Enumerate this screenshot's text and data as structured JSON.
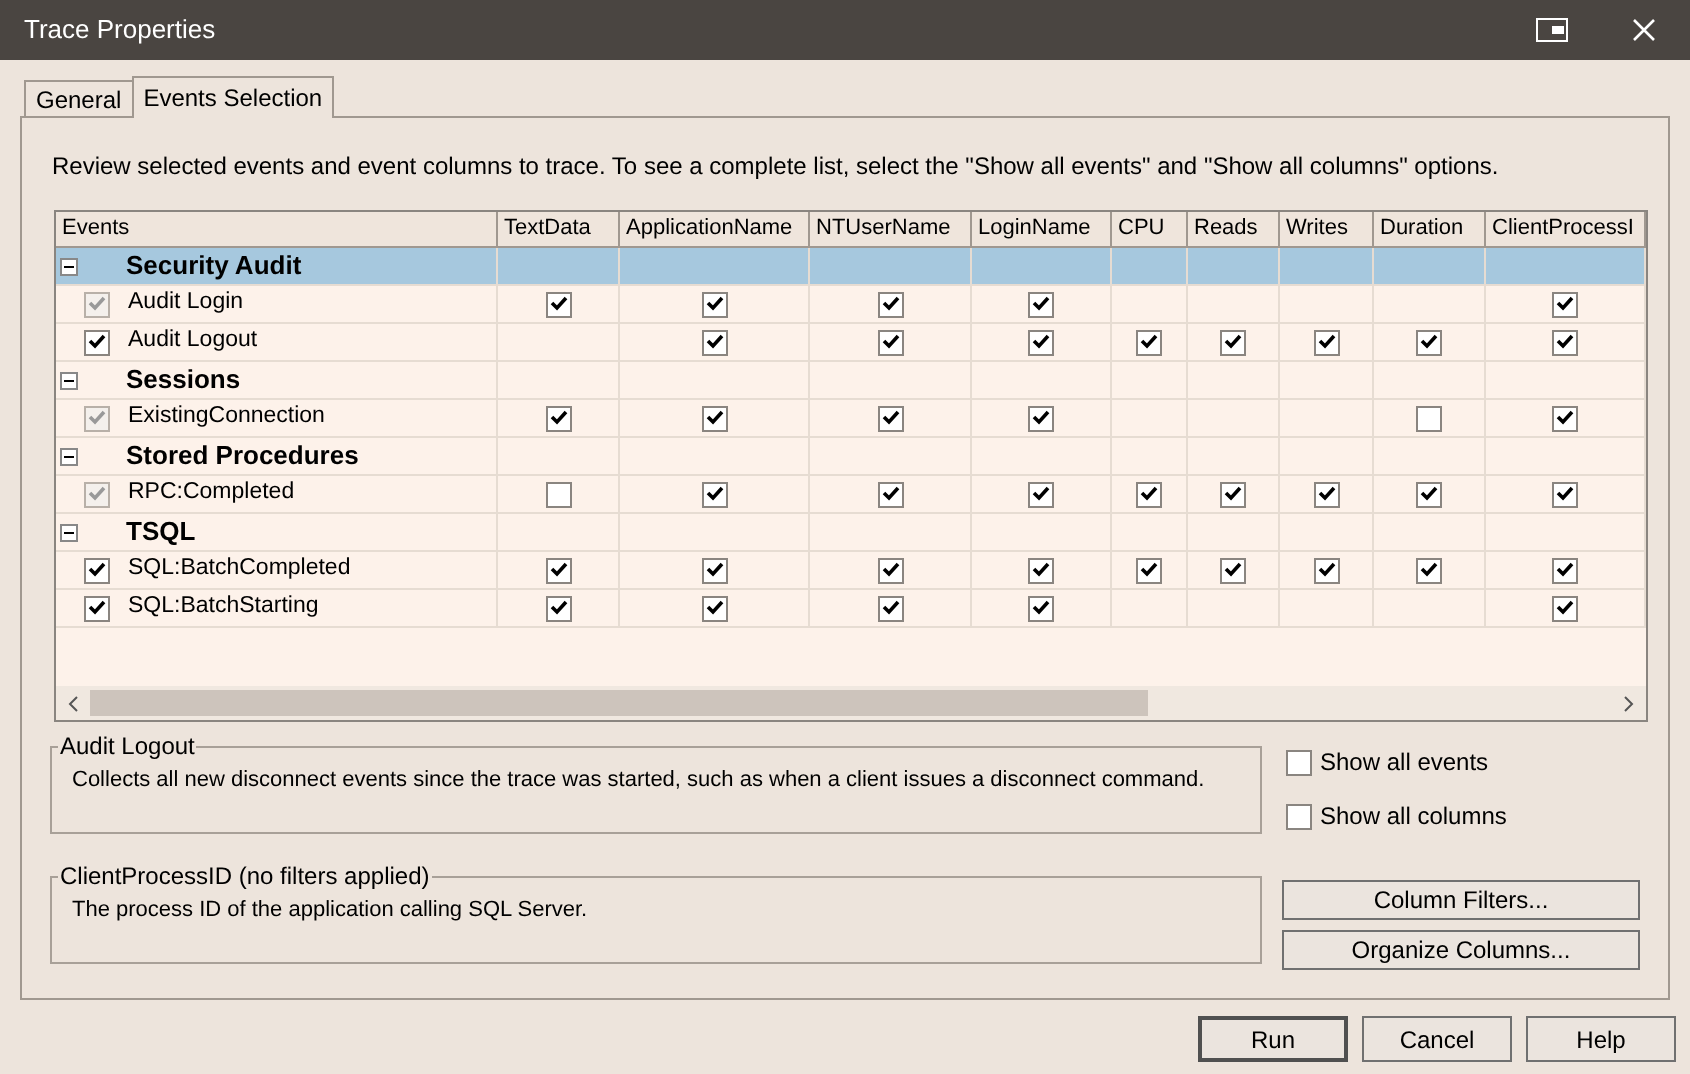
{
  "window": {
    "title": "Trace Properties"
  },
  "tabs": [
    {
      "label": "General",
      "selected": false
    },
    {
      "label": "Events Selection",
      "selected": true
    }
  ],
  "instructions": "Review selected events and event columns to trace. To see a complete list, select the \"Show all events\" and \"Show all columns\" options.",
  "grid": {
    "columns": [
      "Events",
      "TextData",
      "ApplicationName",
      "NTUserName",
      "LoginName",
      "CPU",
      "Reads",
      "Writes",
      "Duration",
      "ClientProcessI"
    ],
    "groups": [
      {
        "name": "Security Audit",
        "expanded": true,
        "selected": true,
        "events": [
          {
            "name": "Audit Login",
            "checked": true,
            "disabled": true,
            "cells": [
              true,
              true,
              true,
              true,
              null,
              null,
              null,
              null,
              true
            ]
          },
          {
            "name": "Audit Logout",
            "checked": true,
            "disabled": false,
            "cells": [
              null,
              true,
              true,
              true,
              true,
              true,
              true,
              true,
              true
            ]
          }
        ]
      },
      {
        "name": "Sessions",
        "expanded": true,
        "selected": false,
        "events": [
          {
            "name": "ExistingConnection",
            "checked": true,
            "disabled": true,
            "cells": [
              true,
              true,
              true,
              true,
              null,
              null,
              null,
              false,
              true
            ]
          }
        ]
      },
      {
        "name": "Stored Procedures",
        "expanded": true,
        "selected": false,
        "events": [
          {
            "name": "RPC:Completed",
            "checked": true,
            "disabled": true,
            "cells": [
              false,
              true,
              true,
              true,
              true,
              true,
              true,
              true,
              true
            ]
          }
        ]
      },
      {
        "name": "TSQL",
        "expanded": true,
        "selected": false,
        "events": [
          {
            "name": "SQL:BatchCompleted",
            "checked": true,
            "disabled": false,
            "cells": [
              true,
              true,
              true,
              true,
              true,
              true,
              true,
              true,
              true
            ]
          },
          {
            "name": "SQL:BatchStarting",
            "checked": true,
            "disabled": false,
            "cells": [
              true,
              true,
              true,
              true,
              null,
              null,
              null,
              null,
              true
            ]
          }
        ]
      }
    ]
  },
  "event_description": {
    "title": "Audit Logout",
    "text": "Collects all new disconnect events since the trace was started, such as when a client issues a disconnect command."
  },
  "options": [
    {
      "label": "Show all events",
      "checked": false
    },
    {
      "label": "Show all columns",
      "checked": false
    }
  ],
  "column_description": {
    "title": "ClientProcessID (no filters applied)",
    "text": "The process ID of the application calling SQL Server."
  },
  "column_buttons": [
    "Column Filters...",
    "Organize Columns..."
  ],
  "dialog_buttons": [
    "Run",
    "Cancel",
    "Help"
  ]
}
